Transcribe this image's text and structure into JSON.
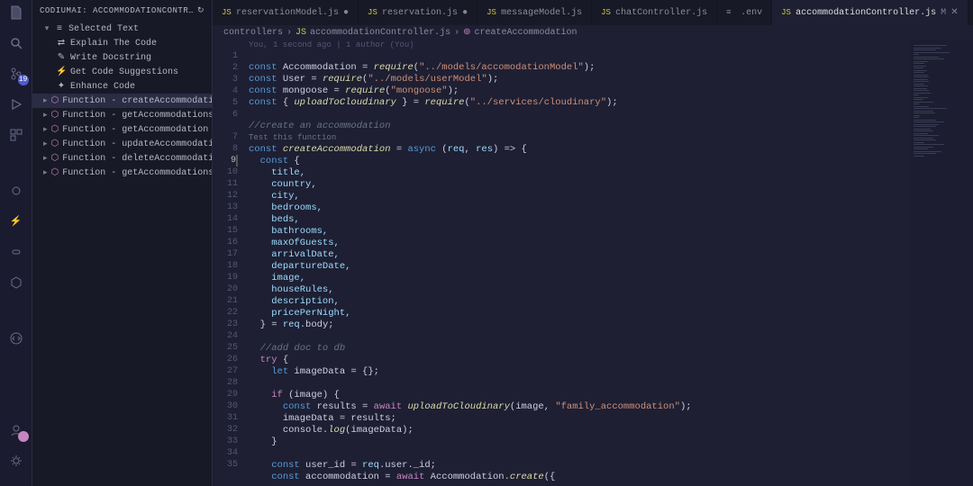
{
  "sidebar_title": "CODIUMAI: ACCOMMODATIONCONTROLLE...",
  "selected_text_label": "Selected Text",
  "commands": [
    {
      "icon": "⇄",
      "label": "Explain The Code"
    },
    {
      "icon": "✎",
      "label": "Write Docstring"
    },
    {
      "icon": "⚡",
      "label": "Get Code Suggestions"
    },
    {
      "icon": "✦",
      "label": "Enhance Code"
    }
  ],
  "functions": [
    {
      "label": "Function - createAccommodation",
      "selected": true
    },
    {
      "label": "Function - getAccommodations"
    },
    {
      "label": "Function - getAccommodation"
    },
    {
      "label": "Function - updateAccommodation"
    },
    {
      "label": "Function - deleteAccommodation"
    },
    {
      "label": "Function - getAccommodationsByFil..."
    }
  ],
  "tabs": [
    {
      "label": "reservationModel.js",
      "modified": true,
      "icon": "JS"
    },
    {
      "label": "reservation.js",
      "modified": true,
      "icon": "JS"
    },
    {
      "label": "messageModel.js",
      "icon": "JS"
    },
    {
      "label": "chatController.js",
      "icon": "JS"
    },
    {
      "label": ".env",
      "icon": "≡"
    },
    {
      "label": "accommodationController.js",
      "active": true,
      "mod": "M",
      "icon": "JS"
    }
  ],
  "breadcrumb": [
    "controllers",
    "accommodationController.js",
    "createAccommodation"
  ],
  "codelens1": "You, 1 second ago | 1 author (You)",
  "codelens2": "Test this function",
  "scm_badge": "19",
  "code": {
    "l1a": "const",
    "l1b": " Accommodation = ",
    "l1c": "require",
    "l1d": "(",
    "l1e": "\"../models/accomodationModel\"",
    "l1f": ");",
    "l2a": "const",
    "l2b": " User = ",
    "l2c": "require",
    "l2d": "(",
    "l2e": "\"../models/userModel\"",
    "l2f": ");",
    "l3a": "const",
    "l3b": " mongoose = ",
    "l3c": "require",
    "l3d": "(",
    "l3e": "\"mongoose\"",
    "l3f": ");",
    "l4a": "const",
    "l4b": " { ",
    "l4c": "uploadToCloudinary",
    "l4d": " } = ",
    "l4e": "require",
    "l4f": "(",
    "l4g": "\"../services/cloudinary\"",
    "l4h": ");",
    "l6": "//create an accommodation",
    "l7a": "const",
    "l7b": " createAccommodation",
    "l7c": " = ",
    "l7d": "async",
    "l7e": " (",
    "l7f": "req",
    "l7g": ", ",
    "l7h": "res",
    "l7i": ") => {",
    "l8a": "const",
    "l8b": " {",
    "l9": "title,",
    "l10": "country,",
    "l11": "city,",
    "l12": "bedrooms,",
    "l13": "beds,",
    "l14": "bathrooms,",
    "l15": "maxOfGuests,",
    "l16": "arrivalDate,",
    "l17": "departureDate,",
    "l18": "image,",
    "l19": "houseRules,",
    "l20": "description,",
    "l21": "pricePerNight,",
    "l22a": "} = ",
    "l22b": "req",
    "l22c": ".body;",
    "l24": "//add doc to db",
    "l25a": "try",
    "l25b": " {",
    "l26a": "let",
    "l26b": " imageData = {};",
    "l28a": "if",
    "l28b": " (image) {",
    "l29a": "const",
    "l29b": " results = ",
    "l29c": "await",
    "l29d": " uploadToCloudinary",
    "l29e": "(image, ",
    "l29f": "\"family_accommodation\"",
    "l29g": ");",
    "l30": "imageData = results;",
    "l31a": "console.",
    "l31b": "log",
    "l31c": "(imageData);",
    "l32": "}",
    "l34a": "const",
    "l34b": " user_id = ",
    "l34c": "req",
    "l34d": ".user._id;",
    "l35a": "const",
    "l35b": " accommodation = ",
    "l35c": "await",
    "l35d": " Accommodation.",
    "l35e": "create",
    "l35f": "({"
  }
}
